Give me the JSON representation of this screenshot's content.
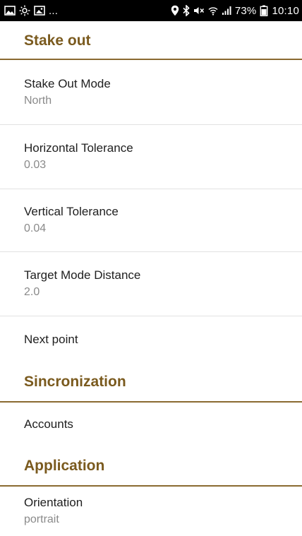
{
  "status_bar": {
    "notification_icons": [
      "image-icon",
      "brightness-icon",
      "gallery-icon"
    ],
    "overflow_text": "...",
    "system_icons": [
      "location-icon",
      "bluetooth-icon",
      "mute-icon",
      "wifi-icon",
      "signal-icon"
    ],
    "battery_percent": "73%",
    "time": "10:10"
  },
  "sections": {
    "stake_out": {
      "title": "Stake out",
      "items": [
        {
          "title": "Stake Out Mode",
          "summary": "North"
        },
        {
          "title": "Horizontal Tolerance",
          "summary": "0.03"
        },
        {
          "title": "Vertical Tolerance",
          "summary": "0.04"
        },
        {
          "title": "Target Mode Distance",
          "summary": "2.0"
        },
        {
          "title": "Next point"
        }
      ]
    },
    "sincronization": {
      "title": "Sincronization",
      "items": [
        {
          "title": "Accounts"
        }
      ]
    },
    "application": {
      "title": "Application",
      "items": [
        {
          "title": "Orientation",
          "summary": "portrait"
        }
      ]
    }
  },
  "colors": {
    "section_header": "#7a5a1e",
    "divider": "#8a6a30",
    "summary_text": "#8a8a8a",
    "status_bar_bg": "#000000"
  }
}
